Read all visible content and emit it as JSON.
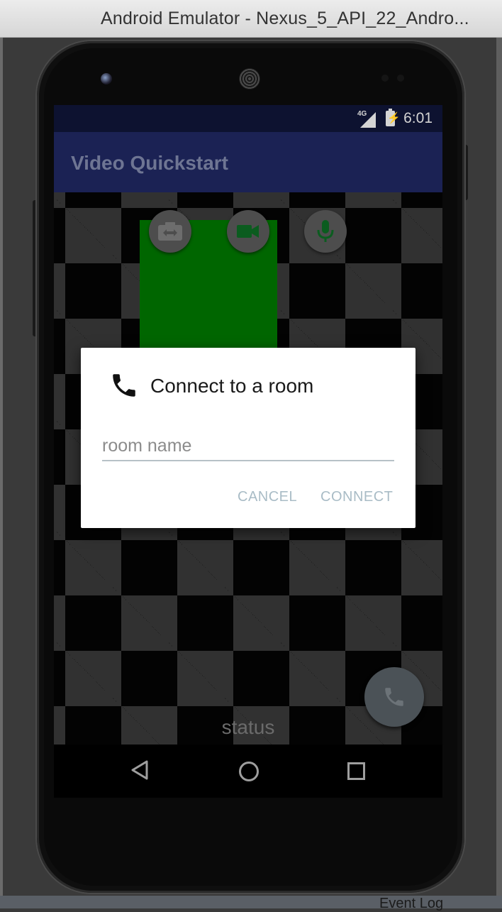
{
  "window": {
    "title": "Android Emulator - Nexus_5_API_22_Andro...",
    "bottom_strip_text": "Event Log"
  },
  "status_bar": {
    "network": "4G",
    "time": "6:01"
  },
  "app_bar": {
    "title": "Video Quickstart"
  },
  "controls": {
    "switch_camera_icon": "switch-camera-icon",
    "video_icon": "videocam-icon",
    "mic_icon": "mic-icon",
    "call_icon": "call-icon"
  },
  "main": {
    "status_text": "status"
  },
  "dialog": {
    "title": "Connect to a room",
    "icon": "phone-icon",
    "room_input": {
      "value": "",
      "placeholder": "room name"
    },
    "cancel_label": "CANCEL",
    "connect_label": "CONNECT"
  },
  "colors": {
    "app_bar": "#1b2254",
    "status_bar": "#0d1230",
    "preview": "#006600",
    "dialog_button": "#a9bcc6",
    "accent_icon": "#0b5c1f"
  }
}
